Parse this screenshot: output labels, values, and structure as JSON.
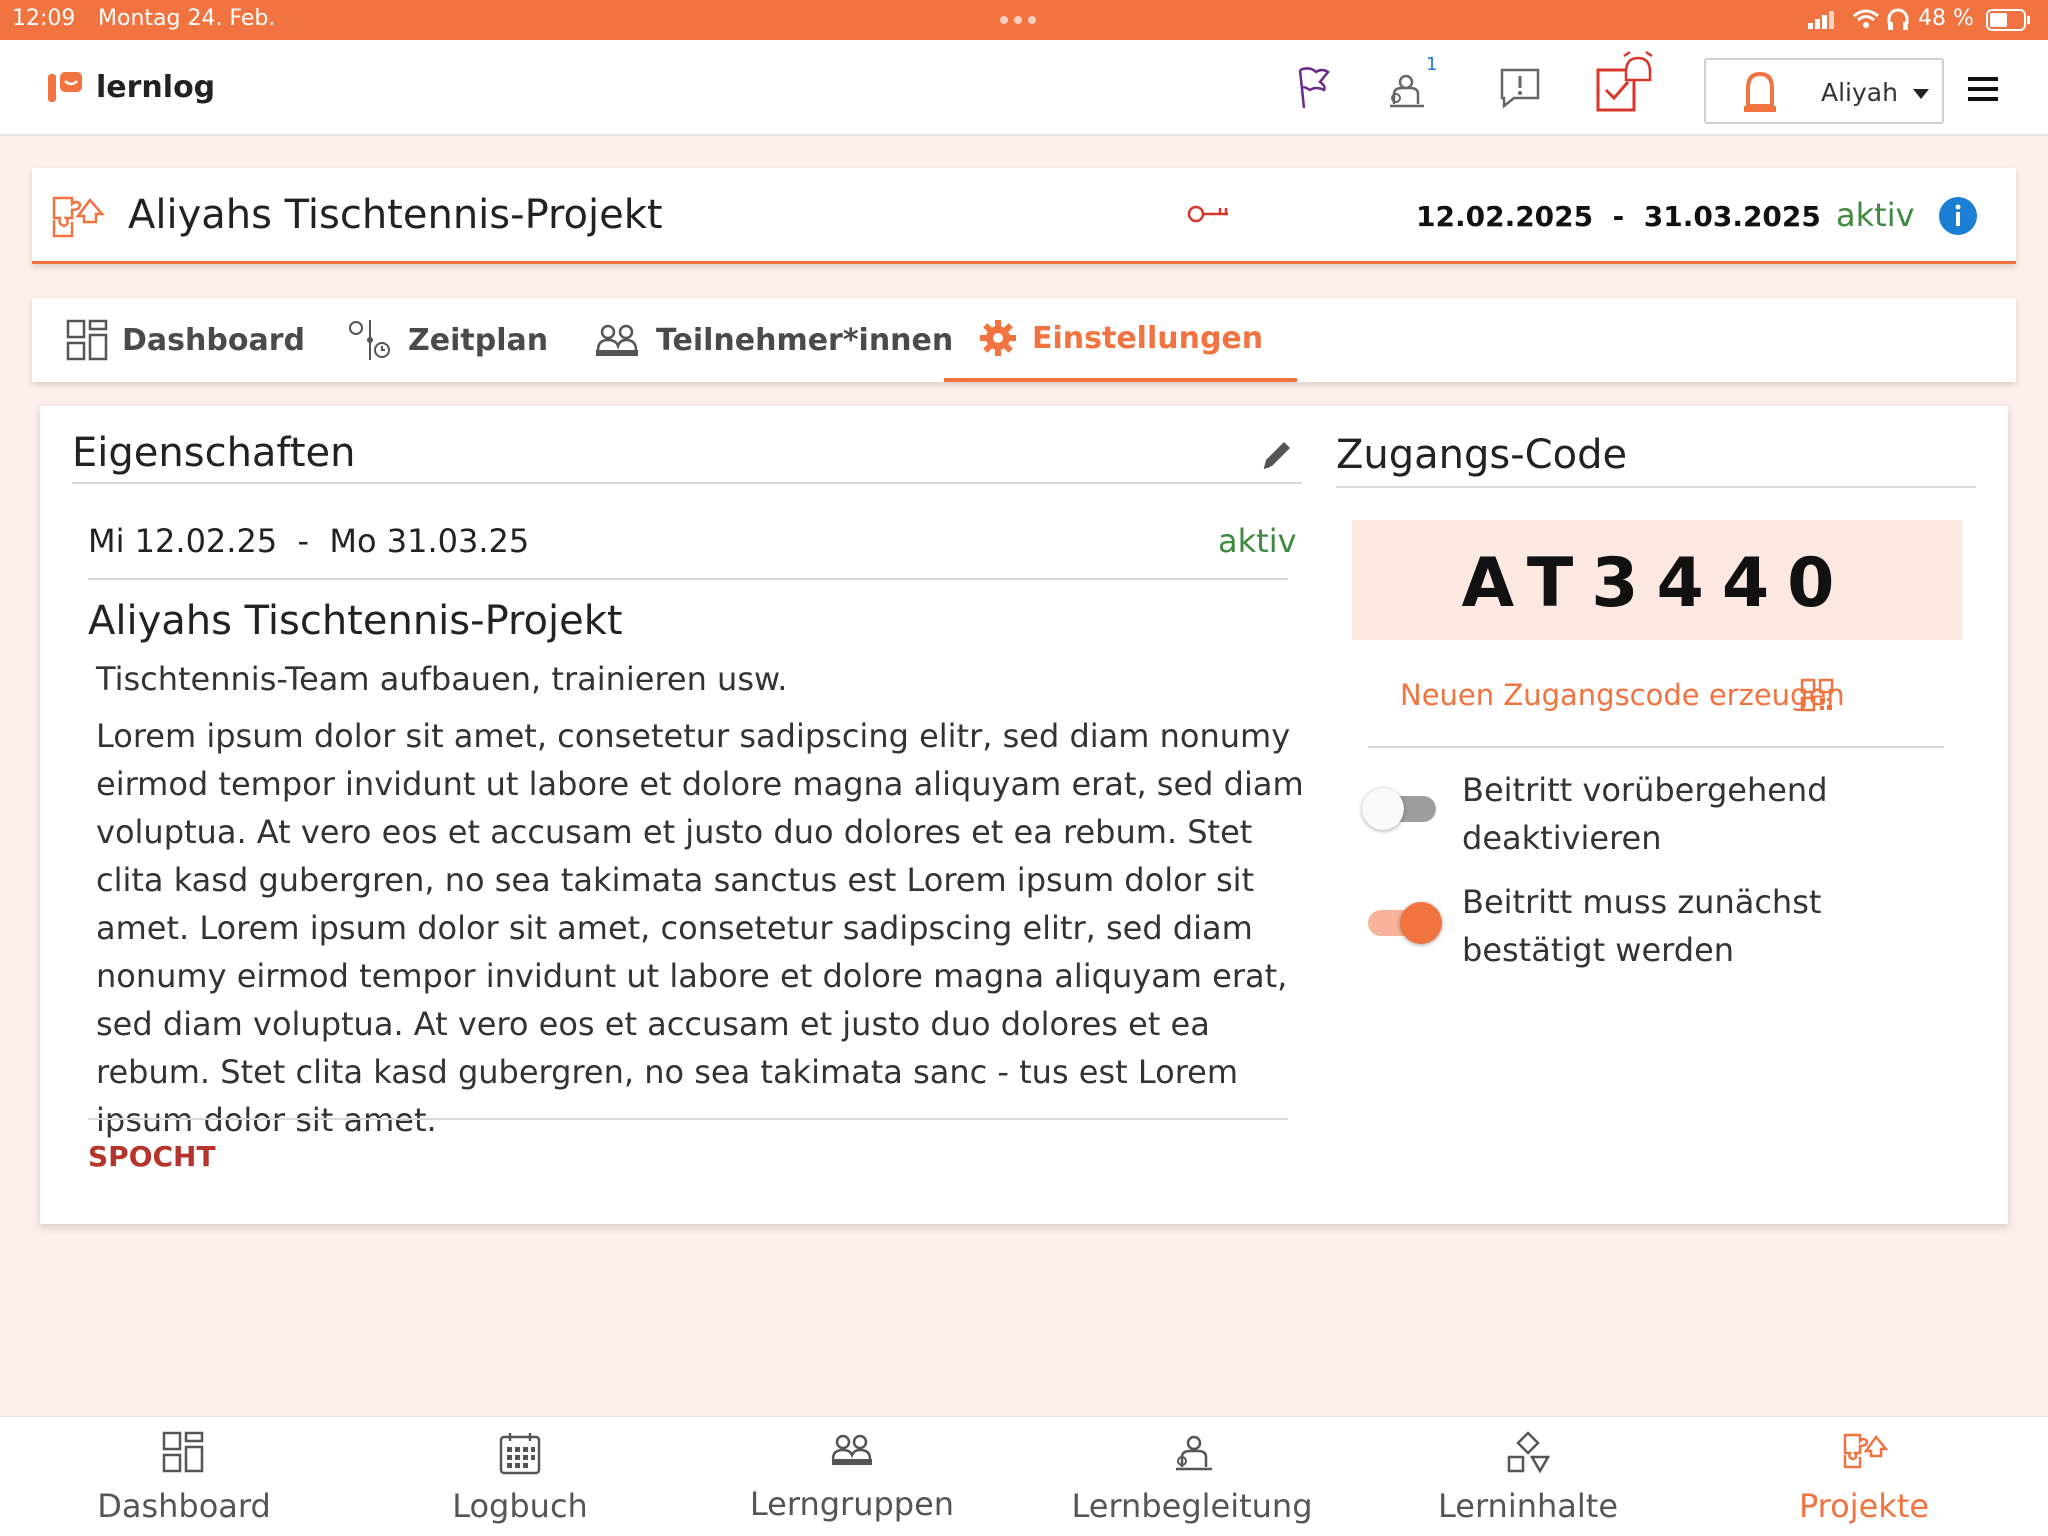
{
  "status_bar": {
    "time": "12:09",
    "date": "Montag 24. Feb.",
    "battery": "48 %"
  },
  "header": {
    "logo_text": "lernlog",
    "notification_count": "1",
    "user_name": "Aliyah"
  },
  "project": {
    "title": "Aliyahs Tischtennis-Projekt",
    "date_range": "12.02.2025  -  31.03.2025",
    "status": "aktiv"
  },
  "tabs": [
    {
      "label": "Dashboard"
    },
    {
      "label": "Zeitplan"
    },
    {
      "label": "Teilnehmer*innen"
    },
    {
      "label": "Einstellungen"
    }
  ],
  "properties": {
    "heading": "Eigenschaften",
    "dates": "Mi 12.02.25  -  Mo 31.03.25",
    "status": "aktiv",
    "name": "Aliyahs Tischtennis-Projekt",
    "subtitle": "Tischtennis-Team aufbauen, trainieren usw.",
    "description": "Lorem ipsum dolor sit amet, consetetur sadipscing elitr, sed diam nonumy eirmod tempor invidunt ut labore et dolore magna aliquyam erat, sed diam voluptua. At vero eos et accusam et justo duo dolores et ea rebum. Stet clita kasd gubergren, no sea takimata sanctus est Lorem ipsum dolor sit amet. Lorem ipsum dolor sit amet, consetetur sadipscing elitr, sed diam nonumy eirmod tempor invidunt ut labore et dolore magna aliquyam erat, sed diam voluptua. At vero eos et accusam et justo duo dolores et ea rebum. Stet clita kasd gubergren, no sea takimata sanc - tus est Lorem ipsum dolor sit amet.",
    "tag": "SPOCHT"
  },
  "access_code": {
    "heading": "Zugangs-Code",
    "code": "AT3440",
    "generate_label": "Neuen Zugangscode erzeugen",
    "toggle1_label": "Beitritt vorübergehend deaktivieren",
    "toggle1_on": false,
    "toggle2_label": "Beitritt muss zunächst bestätigt werden",
    "toggle2_on": true
  },
  "bottom_nav": [
    {
      "label": "Dashboard",
      "active": false
    },
    {
      "label": "Logbuch",
      "active": false
    },
    {
      "label": "Lerngruppen",
      "active": false
    },
    {
      "label": "Lernbegleitung",
      "active": false
    },
    {
      "label": "Lerninhalte",
      "active": false
    },
    {
      "label": "Projekte",
      "active": true
    }
  ],
  "colors": {
    "accent": "#f07340",
    "status_green": "#3f8a3f",
    "tag_red": "#b5342c",
    "info_blue": "#1a7fd4"
  }
}
